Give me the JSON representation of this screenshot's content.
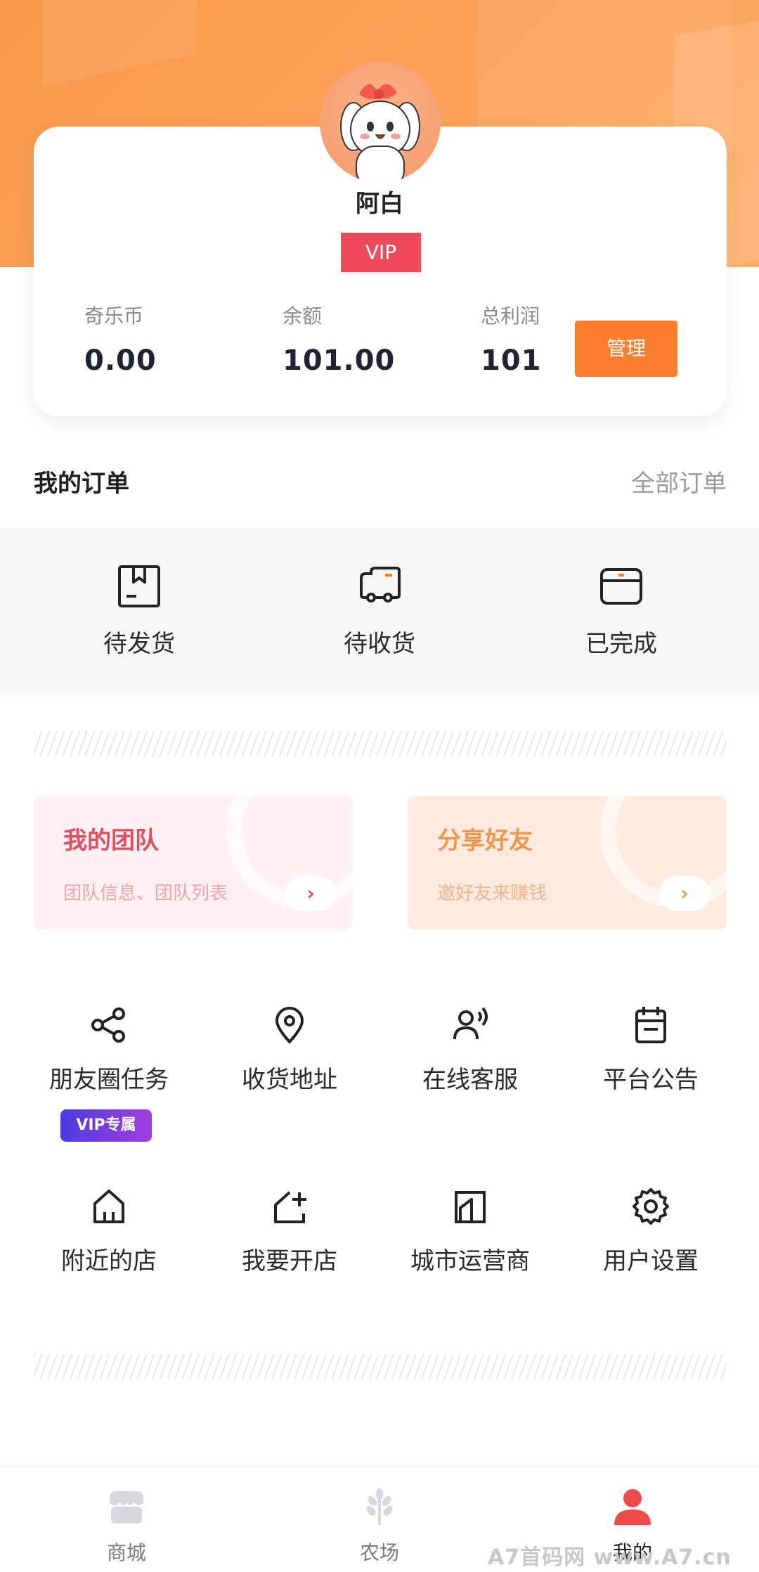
{
  "profile": {
    "name": "阿白",
    "badge": "VIP",
    "stats": [
      {
        "label": "奇乐币",
        "value": "0.00"
      },
      {
        "label": "余额",
        "value": "101.00"
      },
      {
        "label": "总利润",
        "value": "101"
      }
    ],
    "manage_label": "管理"
  },
  "orders": {
    "title": "我的订单",
    "all_label": "全部订单",
    "items": [
      {
        "label": "待发货",
        "icon": "box-icon"
      },
      {
        "label": "待收货",
        "icon": "truck-icon"
      },
      {
        "label": "已完成",
        "icon": "package-done-icon"
      }
    ]
  },
  "promos": [
    {
      "title": "我的团队",
      "subtitle": "团队信息、团队列表",
      "arrow": "›"
    },
    {
      "title": "分享好友",
      "subtitle": "邀好友来赚钱",
      "arrow": "›"
    }
  ],
  "services": [
    {
      "label": "朋友圈任务",
      "icon": "share-icon",
      "tag": "VIP专属"
    },
    {
      "label": "收货地址",
      "icon": "location-pin-icon"
    },
    {
      "label": "在线客服",
      "icon": "customer-service-icon"
    },
    {
      "label": "平台公告",
      "icon": "calendar-notice-icon"
    },
    {
      "label": "附近的店",
      "icon": "home-icon"
    },
    {
      "label": "我要开店",
      "icon": "open-store-icon"
    },
    {
      "label": "城市运营商",
      "icon": "city-building-icon"
    },
    {
      "label": "用户设置",
      "icon": "gear-icon"
    }
  ],
  "tabbar": [
    {
      "label": "商城",
      "icon": "shop-icon",
      "active": false
    },
    {
      "label": "农场",
      "icon": "wheat-icon",
      "active": false
    },
    {
      "label": "我的",
      "icon": "user-icon",
      "active": true
    }
  ],
  "watermark": "A7首码网 www.A7.cn",
  "colors": {
    "brand_orange": "#fb7f2f",
    "vip_red": "#ee4a5c",
    "hero_orange": "#f89a4c"
  }
}
